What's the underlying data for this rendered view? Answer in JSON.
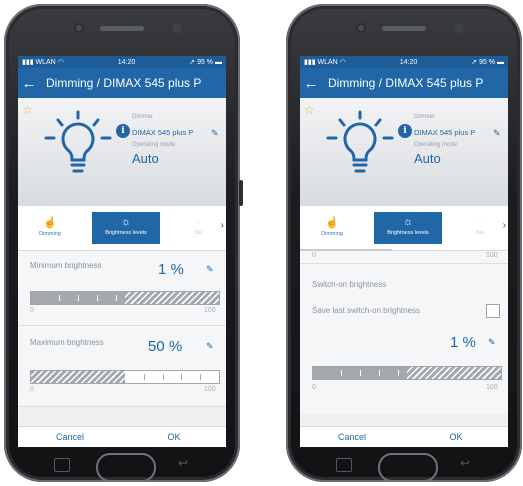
{
  "status": {
    "carrier": "WLAN",
    "time": "14:20",
    "battery": "95 %"
  },
  "appbar": {
    "title": "Dimming / DIMAX 545 plus P"
  },
  "device": {
    "label1": "Dimmer",
    "name": "DIMAX 545 plus P",
    "label2": "Operating mode",
    "mode": "Auto",
    "info_glyph": "i"
  },
  "tabs": {
    "dimming": "Dimming",
    "brightness": "Brightness levels",
    "next": "Sta"
  },
  "left": {
    "min_label": "Minimum brightness",
    "min_value": "1 %",
    "min_fraction": 0.5,
    "max_label": "Maximum brightness",
    "max_value": "50 %",
    "max_fraction": 0.5,
    "scale_min": "0",
    "scale_max": "100"
  },
  "right": {
    "top_scale_min": "0",
    "top_scale_max": "100",
    "switch_label": "Switch-on brightness",
    "save_label": "Save last switch-on brightness",
    "value": "1 %",
    "fraction": 0.5,
    "scale_min": "0",
    "scale_max": "100"
  },
  "buttons": {
    "cancel": "Cancel",
    "ok": "OK"
  },
  "icons": [
    "star-icon",
    "bulb-icon",
    "info-icon",
    "pencil-icon",
    "hand-icon",
    "sun-icon",
    "chevron-right-icon",
    "back-arrow-icon"
  ],
  "colors": {
    "primary": "#2167a7",
    "star": "#f0b43a"
  }
}
